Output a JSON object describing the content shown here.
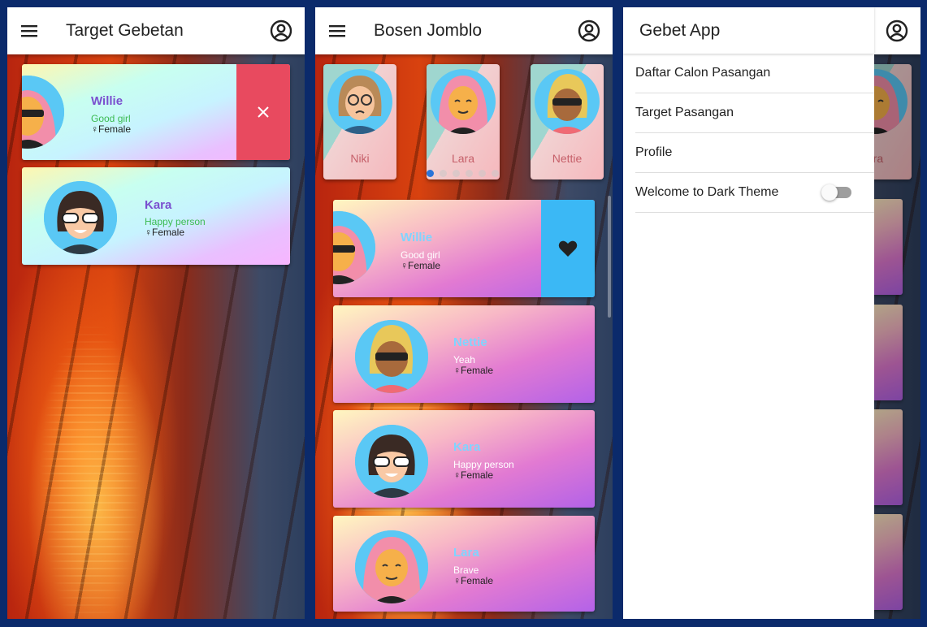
{
  "screen1": {
    "title": "Target Gebetan",
    "cards": [
      {
        "name": "Willie",
        "desc": "Good girl",
        "gender": "Female"
      },
      {
        "name": "Kara",
        "desc": "Happy person",
        "gender": "Female"
      }
    ],
    "swipe_action": "delete"
  },
  "screen2": {
    "title": "Bosen Jomblo",
    "carousel": [
      {
        "name": "Niki"
      },
      {
        "name": "Lara"
      },
      {
        "name": "Nettie"
      }
    ],
    "cards": [
      {
        "name": "Willie",
        "desc": "Good girl",
        "gender": "Female"
      },
      {
        "name": "Nettie",
        "desc": "Yeah",
        "gender": "Female"
      },
      {
        "name": "Kara",
        "desc": "Happy person",
        "gender": "Female"
      },
      {
        "name": "Lara",
        "desc": "Brave",
        "gender": "Female"
      }
    ],
    "swipe_action": "favorite"
  },
  "screen3": {
    "drawer_title": "Gebet App",
    "drawer_items": [
      {
        "label": "Daftar Calon Pasangan"
      },
      {
        "label": "Target Pasangan"
      },
      {
        "label": "Profile"
      },
      {
        "label": "Welcome to Dark Theme",
        "toggle": false
      }
    ],
    "peek_label": "ara"
  },
  "colors": {
    "delete_red": "#e84a5f",
    "favorite_blue": "#3bb8f5",
    "name_purple": "#7a4fcf",
    "desc_green": "#3dbb52",
    "name_light": "#7fd4ff"
  },
  "icons": [
    "menu-icon",
    "account-circle-icon",
    "close-icon",
    "heart-icon",
    "female-icon"
  ]
}
